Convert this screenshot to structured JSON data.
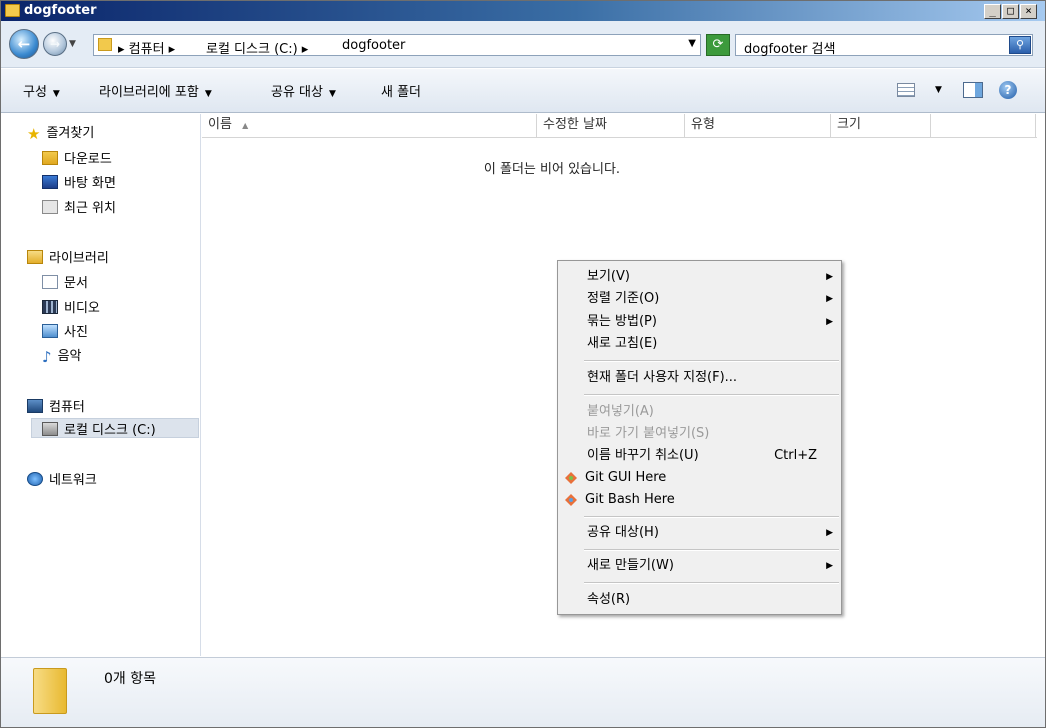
{
  "window": {
    "title": "dogfooter"
  },
  "title_buttons": {
    "minimize": "_",
    "maximize": "□",
    "close": "×"
  },
  "address": {
    "crumbs": [
      "▸ 컴퓨터 ▸",
      "로컬 디스크 (C:) ▸",
      "dogfooter"
    ],
    "search_placeholder": "dogfooter 검색"
  },
  "toolbar": {
    "organize": "구성",
    "include_library": "라이브러리에 포함",
    "share_with": "공유 대상",
    "new_folder": "새 폴더"
  },
  "nav": {
    "favorites": "즐겨찾기",
    "downloads": "다운로드",
    "desktop": "바탕 화면",
    "recent": "최근 위치",
    "libraries": "라이브러리",
    "documents": "문서",
    "videos": "비디오",
    "pictures": "사진",
    "music": "음악",
    "computer": "컴퓨터",
    "local_disk": "로컬 디스크 (C:)",
    "network": "네트워크"
  },
  "columns": {
    "name": "이름",
    "date": "수정한 날짜",
    "type": "유형",
    "size": "크기"
  },
  "empty_message": "이 폴더는 비어 있습니다.",
  "details": {
    "item_count": "0개 항목"
  },
  "context_menu": {
    "view": "보기(V)",
    "sort_by": "정렬 기준(O)",
    "group_by": "묶는 방법(P)",
    "refresh": "새로 고침(E)",
    "customize": "현재 폴더 사용자 지정(F)...",
    "paste": "붙여넣기(A)",
    "paste_shortcut": "바로 가기 붙여넣기(S)",
    "undo_rename": "이름 바꾸기 취소(U)",
    "undo_shortcut": "Ctrl+Z",
    "git_gui": "Git GUI Here",
    "git_bash": "Git Bash Here",
    "share_with": "공유 대상(H)",
    "new": "새로 만들기(W)",
    "properties": "속성(R)"
  }
}
